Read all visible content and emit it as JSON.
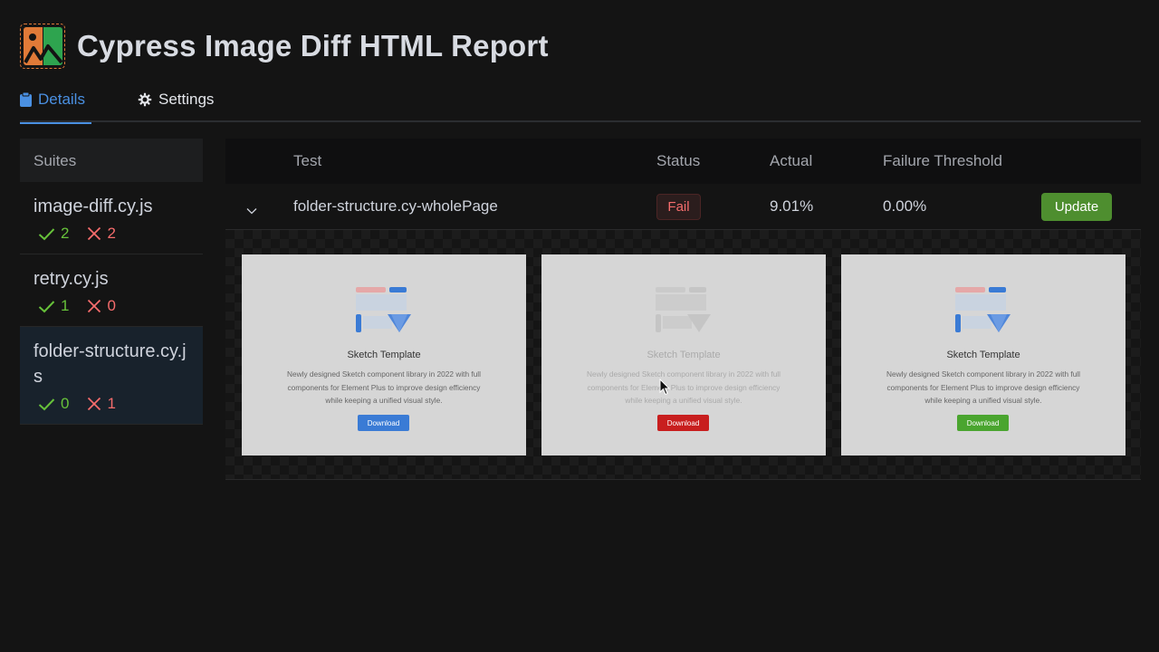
{
  "app": {
    "title": "Cypress Image Diff HTML Report"
  },
  "tabs": {
    "details": "Details",
    "settings": "Settings"
  },
  "sidebar": {
    "header": "Suites",
    "suites": [
      {
        "name": "image-diff.cy.js",
        "passed": "2",
        "failed": "2"
      },
      {
        "name": "retry.cy.js",
        "passed": "1",
        "failed": "0"
      },
      {
        "name": "folder-structure.cy.js",
        "passed": "0",
        "failed": "1"
      }
    ]
  },
  "table": {
    "columns": {
      "test": "Test",
      "status": "Status",
      "actual": "Actual",
      "threshold": "Failure Threshold"
    },
    "rows": [
      {
        "test": "folder-structure.cy-wholePage",
        "status": "Fail",
        "actual": "9.01%",
        "threshold": "0.00%",
        "action": "Update"
      }
    ]
  },
  "preview": {
    "title": "Sketch Template",
    "description": "Newly designed Sketch component library in 2022 with full components for Element Plus to improve design efficiency while keeping a unified visual style.",
    "button": "Download"
  },
  "colors": {
    "accent": "#4a90e2",
    "pass": "#67c23a",
    "fail": "#f56c6c",
    "update_button": "#4e8e2f",
    "baseline_download": "#3a7bd5",
    "diff_download": "#c81e1e",
    "comparison_download": "#4aa52f"
  },
  "icons": {
    "details_tab": "clipboard-icon",
    "settings_tab": "gear-icon",
    "pass": "check-icon",
    "fail": "cross-icon",
    "expand": "chevron-down-icon"
  }
}
